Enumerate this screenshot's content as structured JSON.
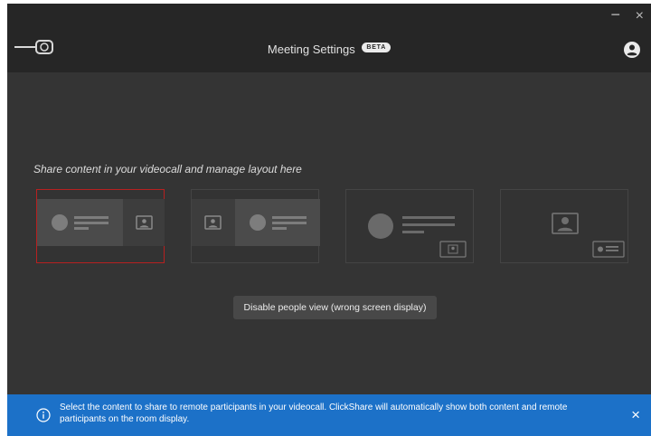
{
  "window": {
    "minimize_glyph": "−",
    "close_glyph": "×",
    "title": "Meeting Settings",
    "badge": "BETA"
  },
  "icons": {
    "device": "clickshare-dongle-icon",
    "user": "user-account-icon",
    "info": "info-icon",
    "close": "close-icon"
  },
  "main": {
    "heading": "Share content in your videocall and manage layout here",
    "layouts": [
      {
        "name": "content-and-people-side-by-side",
        "selected": true
      },
      {
        "name": "people-and-content-side-by-side",
        "selected": false
      },
      {
        "name": "content-with-people-picture-in-picture",
        "selected": false
      },
      {
        "name": "people-with-content-picture-in-picture",
        "selected": false
      }
    ],
    "people_view_button": "Disable people view (wrong screen display)"
  },
  "banner": {
    "text": "Select the content to share to remote participants in your videocall. ClickShare will automatically show both content and remote participants on the room display.",
    "close_glyph": "×"
  },
  "colors": {
    "background": "#343434",
    "titlebar": "#262626",
    "banner": "#1c71c8",
    "selected_border": "#b72020"
  }
}
